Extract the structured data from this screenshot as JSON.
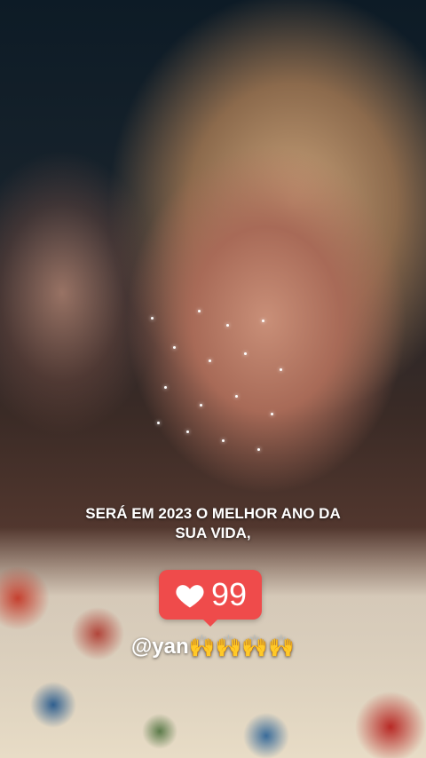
{
  "caption": {
    "line1": "SERÁ EM 2023 O MELHOR ANO DA",
    "line2": "SUA VIDA,"
  },
  "like_badge": {
    "count": "99",
    "icon": "heart-icon",
    "color": "#ef4b4b"
  },
  "mention": {
    "handle": "@yan",
    "emojis": "🙌🙌🙌🙌"
  }
}
